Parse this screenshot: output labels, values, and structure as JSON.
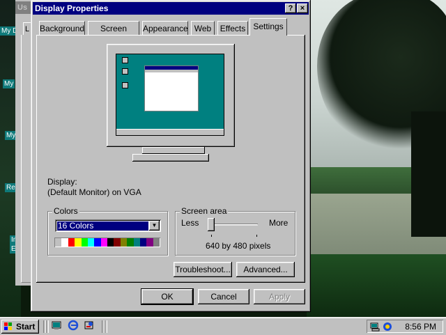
{
  "desktop": {
    "icon_labels": [
      "Us",
      "My D",
      "My",
      "My",
      "Re",
      "In",
      "E"
    ],
    "wallpaper": "park-tree-scene"
  },
  "background_window": {
    "title_fragment": "Us",
    "tab_fragment": "L"
  },
  "dialog": {
    "title": "Display Properties",
    "help_label": "?",
    "close_label": "×",
    "tabs": [
      {
        "label": "Background",
        "active": false
      },
      {
        "label": "Screen Saver",
        "active": false
      },
      {
        "label": "Appearance",
        "active": false
      },
      {
        "label": "Web",
        "active": false
      },
      {
        "label": "Effects",
        "active": false
      },
      {
        "label": "Settings",
        "active": true
      }
    ],
    "display_label": "Display:",
    "display_value": "(Default Monitor) on VGA",
    "colors": {
      "group_label": "Colors",
      "selected": "16 Colors",
      "palette": [
        "#c0c0c0",
        "#ffffff",
        "#ff0000",
        "#ffff00",
        "#00ff00",
        "#00ffff",
        "#0000ff",
        "#ff00ff",
        "#000000",
        "#800000",
        "#808000",
        "#008000",
        "#008080",
        "#000080",
        "#800080",
        "#808080"
      ]
    },
    "screen_area": {
      "group_label": "Screen area",
      "less_label": "Less",
      "more_label": "More",
      "resolution": "640 by 480 pixels",
      "slider_level": 0
    },
    "buttons": {
      "troubleshoot": "Troubleshoot...",
      "advanced": "Advanced...",
      "ok": "OK",
      "cancel": "Cancel",
      "apply": "Apply"
    }
  },
  "taskbar": {
    "start_label": "Start",
    "clock": "8:56 PM",
    "quick_launch": [
      "desktop-icon",
      "internet-explorer-icon",
      "channels-icon"
    ]
  }
}
